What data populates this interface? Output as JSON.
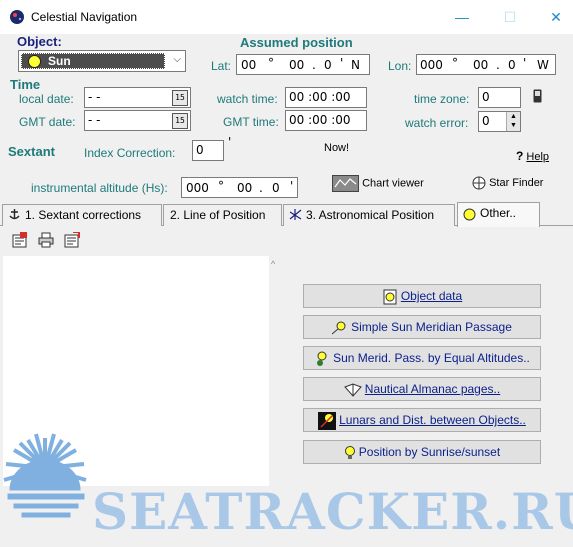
{
  "window": {
    "title": "Celestial Navigation",
    "minimize_glyph": "—",
    "maximize_glyph": "☐",
    "close_glyph": "✕"
  },
  "object": {
    "label": "Object:",
    "selected": "Sun"
  },
  "assumed_position": {
    "heading": "Assumed position",
    "lat_label": "Lat:",
    "lat_deg": "00",
    "lat_min": "00",
    "lat_tenth": "0",
    "lat_hemi": "N",
    "lon_label": "Lon:",
    "lon_deg": "000",
    "lon_min": "00",
    "lon_tenth": "0",
    "lon_hemi": "W"
  },
  "time": {
    "heading": "Time",
    "local_date_label": "local date:",
    "local_date_value": "  -  -",
    "gmt_date_label": "GMT date:",
    "gmt_date_value": "  -  -",
    "watch_time_label": "watch time:",
    "watch_time_value": "00 :00 :00",
    "gmt_time_label": "GMT time:",
    "gmt_time_value": "00 :00 :00",
    "time_zone_label": "time zone:",
    "time_zone_value": "0",
    "watch_error_label": "watch error:",
    "watch_error_value": "0",
    "calendar_glyph": "15"
  },
  "sextant": {
    "heading": "Sextant",
    "index_correction_label": "Index Correction:",
    "index_correction_value": "0",
    "index_unit": "'",
    "now_label": "Now!",
    "help_label": "Help",
    "hs_label": "instrumental altitude (Hs):",
    "hs_deg": "000",
    "hs_min": "00",
    "hs_tenth": "0",
    "chart_viewer_label": "Chart viewer",
    "star_finder_label": "Star Finder"
  },
  "tabs": [
    {
      "label": "1. Sextant corrections"
    },
    {
      "label": "2. Line of Position"
    },
    {
      "label": "3. Astronomical Position"
    },
    {
      "label": "Other.."
    }
  ],
  "actions": [
    {
      "label": "Object data"
    },
    {
      "label": "Simple Sun Meridian Passage"
    },
    {
      "label": "Sun Merid. Pass. by Equal Altitudes.."
    },
    {
      "label": "Nautical Almanac pages.."
    },
    {
      "label": "Lunars and Dist. between Objects.."
    },
    {
      "label": "Position by Sunrise/sunset"
    }
  ],
  "watermark": {
    "text": "SEATRACKER.RU"
  },
  "colors": {
    "label_teal": "#1f7a7a",
    "heading_navy": "#1a237e",
    "button_text": "#0a1f8a",
    "sun_yellow": "#ffff33",
    "watermark_blue": "#a9c8e8"
  }
}
